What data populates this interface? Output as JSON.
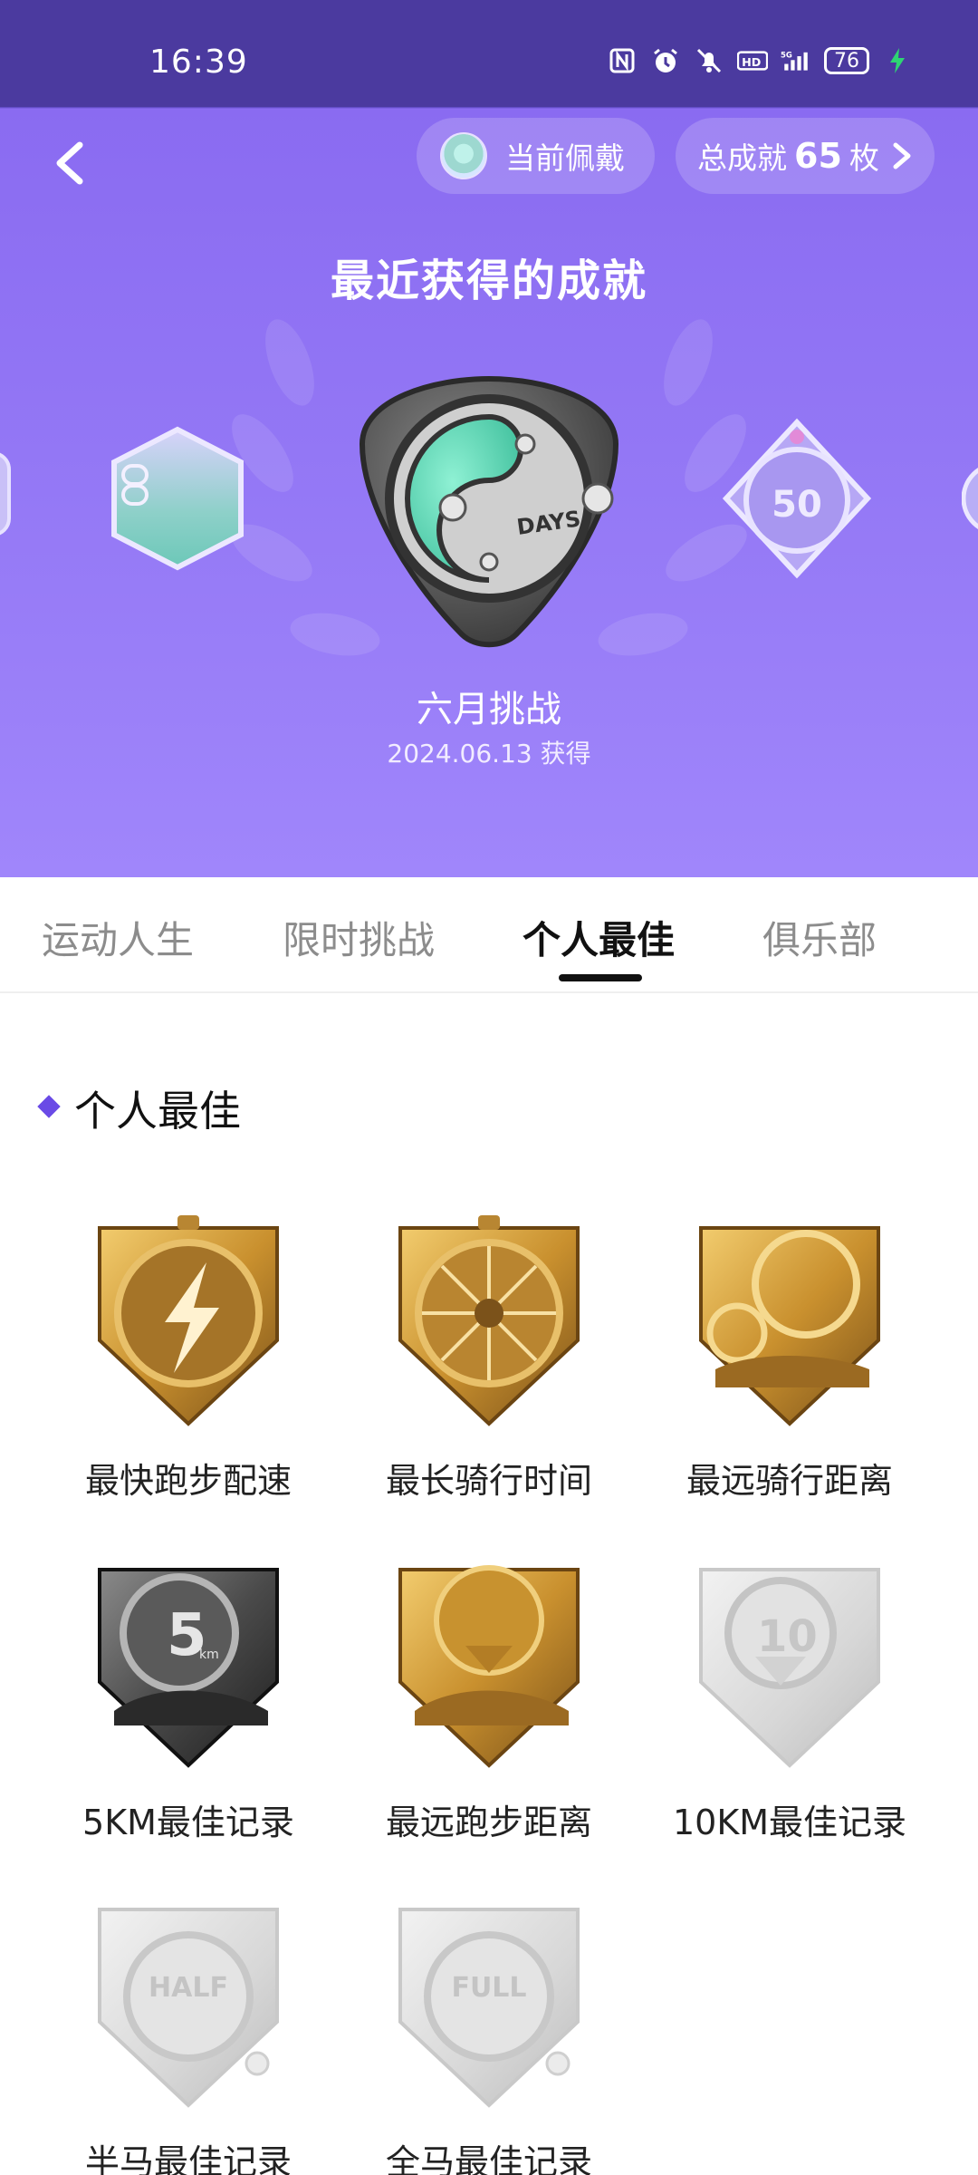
{
  "status_bar": {
    "time": "16:39",
    "icons": [
      "nfc-icon",
      "alarm-icon",
      "mute-icon",
      "hd-icon",
      "signal-5g-icon"
    ],
    "battery": "76"
  },
  "header": {
    "current_wearing_label": "当前佩戴",
    "total_prefix": "总成就",
    "total_count": "65",
    "total_suffix": "枚"
  },
  "hero": {
    "title": "最近获得的成就",
    "medal_name": "六月挑战",
    "medal_date": "2024.06.13 获得"
  },
  "tabs": [
    {
      "label": "运动人生",
      "active": false
    },
    {
      "label": "限时挑战",
      "active": false
    },
    {
      "label": "个人最佳",
      "active": true
    },
    {
      "label": "俱乐部",
      "active": false
    }
  ],
  "section": {
    "title": "个人最佳",
    "items": [
      {
        "label": "最快跑步配速",
        "tone": "gold"
      },
      {
        "label": "最长骑行时间",
        "tone": "gold"
      },
      {
        "label": "最远骑行距离",
        "tone": "gold"
      },
      {
        "label": "5KM最佳记录",
        "tone": "dark"
      },
      {
        "label": "最远跑步距离",
        "tone": "gold"
      },
      {
        "label": "10KM最佳记录",
        "tone": "gray"
      },
      {
        "label": "半马最佳记录",
        "tone": "gray"
      },
      {
        "label": "全马最佳记录",
        "tone": "gray"
      }
    ]
  },
  "colors": {
    "accent": "#6a4ae6",
    "gold": "#c9902e",
    "hero_top": "#4b3a9f",
    "hero_bottom": "#a086fb"
  }
}
